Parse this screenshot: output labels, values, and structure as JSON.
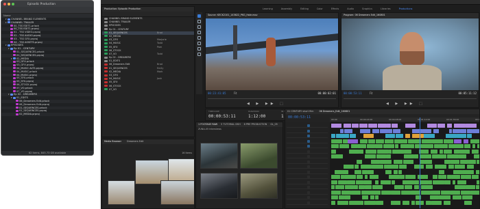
{
  "finder": {
    "title": "Episodic Production",
    "column_header": "Name",
    "rows": [
      {
        "label": "CHANNEL BRAND ELEMENTS",
        "indent": 1,
        "color": "#5b8cff",
        "kind": "folder"
      },
      {
        "label": "CHANNEL TRAILER",
        "indent": 1,
        "color": "#5b8cff",
        "kind": "folder"
      },
      {
        "label": "00_TSS EDIT1.prlock",
        "indent": 2,
        "color": "#c23ad0",
        "kind": "file"
      },
      {
        "label": "00_TSS EDIT1.prproj",
        "indent": 2,
        "color": "#c23ad0",
        "kind": "file"
      },
      {
        "label": "01 - TSS VIDEO.prproj",
        "indent": 2,
        "color": "#c23ad0",
        "kind": "file"
      },
      {
        "label": "02 - TSS AUDIO.prproj",
        "indent": 2,
        "color": "#c23ad0",
        "kind": "file"
      },
      {
        "label": "03 - TSS GFX.prproj",
        "indent": 2,
        "color": "#c23ad0",
        "kind": "file"
      },
      {
        "label": "04 - TSS ASSETS.prproj",
        "indent": 2,
        "color": "#c23ad0",
        "kind": "file"
      },
      {
        "label": "EPISODES",
        "indent": 1,
        "color": "#5b8cff",
        "kind": "folder"
      },
      {
        "label": "Ep 01 - CENTURY",
        "indent": 2,
        "color": "#5b8cff",
        "kind": "folder"
      },
      {
        "label": "01_SEQUENCES.prlock",
        "indent": 3,
        "color": "#c23ad0",
        "kind": "file"
      },
      {
        "label": "01_SEQUENCES.prproj",
        "indent": 3,
        "color": "#c23ad0",
        "kind": "file"
      },
      {
        "label": "02_MEDIA",
        "indent": 3,
        "color": "#5b8cff",
        "kind": "folder"
      },
      {
        "label": "03_GFX.prlock",
        "indent": 3,
        "color": "#c23ad0",
        "kind": "file"
      },
      {
        "label": "03_GFX.prproj",
        "indent": 3,
        "color": "#c23ad0",
        "kind": "file"
      },
      {
        "label": "04_MUSIC ALTS.prproj",
        "indent": 3,
        "color": "#c23ad0",
        "kind": "file"
      },
      {
        "label": "04_MUSIC.prlock",
        "indent": 3,
        "color": "#c23ad0",
        "kind": "file"
      },
      {
        "label": "04_MUSIC.prproj",
        "indent": 3,
        "color": "#c23ad0",
        "kind": "file"
      },
      {
        "label": "05_SFX.prlock",
        "indent": 3,
        "color": "#c23ad0",
        "kind": "file"
      },
      {
        "label": "05_SFX.prproj",
        "indent": 3,
        "color": "#c23ad0",
        "kind": "file"
      },
      {
        "label": "06_STOCK.prproj",
        "indent": 3,
        "color": "#c23ad0",
        "kind": "file"
      },
      {
        "label": "07_VO.prlock",
        "indent": 3,
        "color": "#c23ad0",
        "kind": "file"
      },
      {
        "label": "07_VO.prproj",
        "indent": 3,
        "color": "#c23ad0",
        "kind": "file"
      },
      {
        "label": "Ep 02 - DREAMERS",
        "indent": 2,
        "color": "#5b8cff",
        "kind": "folder"
      },
      {
        "label": "01_EDITS",
        "indent": 3,
        "color": "#5b8cff",
        "kind": "folder"
      },
      {
        "label": "06_Dreamers Edit.prlock",
        "indent": 4,
        "color": "#c23ad0",
        "kind": "file"
      },
      {
        "label": "06_Dreamers Edit.prproj",
        "indent": 4,
        "color": "#c23ad0",
        "kind": "file"
      },
      {
        "label": "01_SEQUENCES.prlock",
        "indent": 4,
        "color": "#c23ad0",
        "kind": "file"
      },
      {
        "label": "01_SEQUENCES.prproj",
        "indent": 4,
        "color": "#c23ad0",
        "kind": "file"
      },
      {
        "label": "02_MEDIA.prproj",
        "indent": 4,
        "color": "#c23ad0",
        "kind": "file"
      }
    ],
    "status": "62 items, 845.73 GB available"
  },
  "app": {
    "workspaces": [
      "Learning",
      "Assembly",
      "Editing",
      "Color",
      "Effects",
      "Audio",
      "Graphics",
      "Libraries",
      "Productions"
    ],
    "active_workspace": "Productions",
    "production_panel": {
      "tab": "Production: Episodic Production",
      "rows": [
        {
          "label": "CHANNEL BRAND ELEMENTS",
          "color": "#888"
        },
        {
          "label": "CHANNEL TRAILER",
          "color": "#888"
        },
        {
          "label": "EPISODES",
          "color": "#888"
        },
        {
          "label": "Ep 01 - CENTURY",
          "color": "#888"
        },
        {
          "label": "01_SEQUENCES",
          "color": "#2a9d5a",
          "who": "Brad"
        },
        {
          "label": "02_MEDIA",
          "color": "#2a9d5a"
        },
        {
          "label": "03_GFX",
          "color": "#2a9d5a",
          "who": "Marjorie"
        },
        {
          "label": "04_MUSIC",
          "color": "#2a9d5a",
          "who": "Todd"
        },
        {
          "label": "05_SFX",
          "color": "#2a9d5a",
          "who": "Pam"
        },
        {
          "label": "06_STOCK",
          "color": "#2a9d5a"
        },
        {
          "label": "07_VO",
          "color": "#2a9d5a",
          "who": "Todd"
        },
        {
          "label": "Ep 02 - DREAMERS",
          "color": "#888"
        },
        {
          "label": "01_EDITS",
          "color": "#888"
        },
        {
          "label": "06_Dreamers Edit",
          "color": "#c23030",
          "who": "Brad"
        },
        {
          "label": "01_SEQUENCES",
          "color": "#c23030",
          "who": "Emily"
        },
        {
          "label": "02_MEDIA",
          "color": "#c23030",
          "who": "Mark"
        },
        {
          "label": "03_GFX",
          "color": "#c23030"
        },
        {
          "label": "04_MUSIC",
          "color": "#c23030",
          "who": "Josh"
        },
        {
          "label": "05_SFX",
          "color": "#c23030"
        },
        {
          "label": "06_STOCK",
          "color": "#c23030"
        },
        {
          "label": "07_VO",
          "color": "#2a9d5a"
        }
      ]
    },
    "source_monitor": {
      "tab": "Source: KECK2101_143622_PKG_Hale.mov",
      "timecode_in": "00:23:41:05",
      "timecode_out": "00:00:02:01",
      "fit": "Fit"
    },
    "program_monitor": {
      "tab": "Program: 06 Dreamers Edit_160801",
      "timecode_in": "00:00:53:11",
      "timecode_out": "00:05:11:12",
      "fit": "Fit"
    },
    "metadata_bar": {
      "timecode": "00:00:53:11",
      "duration_label": "DURATION",
      "duration": "1:12:00",
      "intro_label": "IN TO OUT",
      "intro": "1:12:00"
    },
    "bin_panel": {
      "tab": "Media Browser",
      "items_label": "Dreamers Edit",
      "count": "16 Items"
    },
    "media_bin": {
      "tabs": [
        "1 FOOTAGE RAW",
        "5 TUTORIAL DSH",
        "6 PRE PRODUCTION",
        "GL_05"
      ],
      "title": "ZUNA-05 Interviews"
    },
    "timeline": {
      "tabs": [
        "01 CENTURY short film",
        "06 Dreamers_Edit_160801"
      ],
      "timecode": "00:00:53:11",
      "ruler": [
        "00:00",
        "00:00:24:00",
        "00:00:48:00",
        "00:01:12:00",
        "00:01:36:00",
        "00:02:00:00"
      ]
    }
  }
}
